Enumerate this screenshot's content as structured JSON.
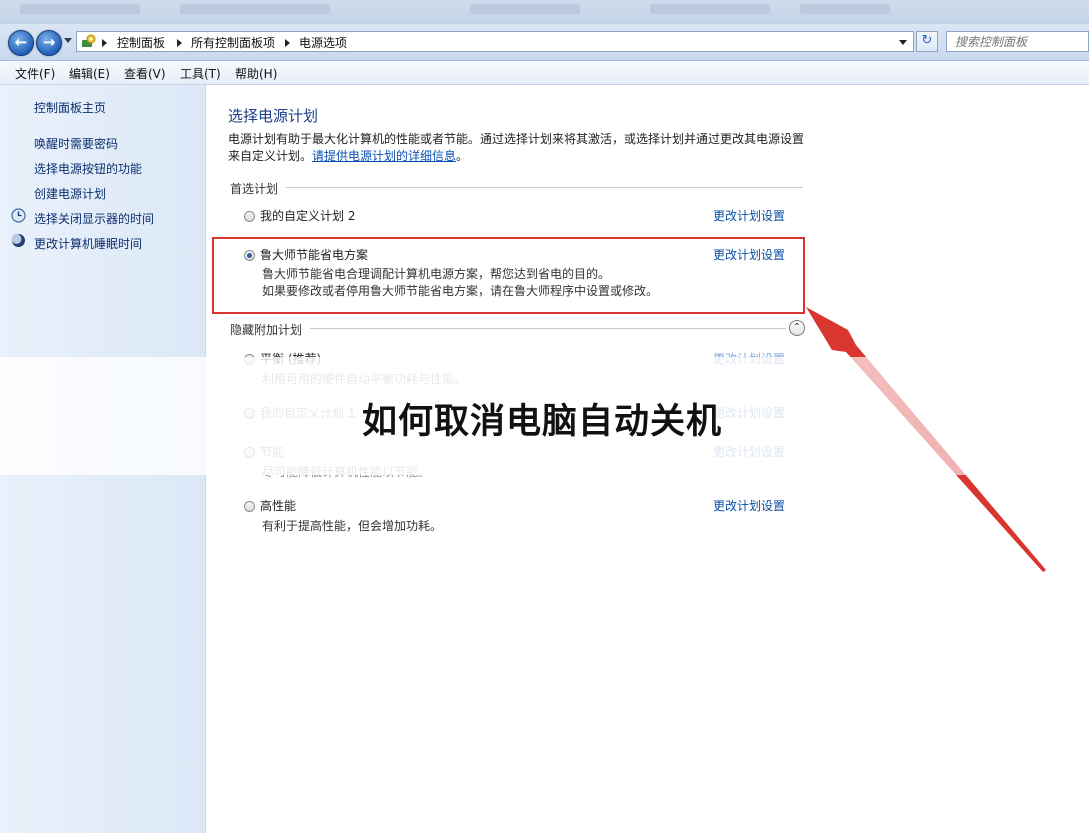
{
  "address": {
    "crumbs": [
      "控制面板",
      "所有控制面板项",
      "电源选项"
    ],
    "search_placeholder": "搜索控制面板"
  },
  "menu": [
    "文件(F)",
    "编辑(E)",
    "查看(V)",
    "工具(T)",
    "帮助(H)"
  ],
  "sidebar": {
    "home": "控制面板主页",
    "items": [
      {
        "label": "唤醒时需要密码",
        "icon": null
      },
      {
        "label": "选择电源按钮的功能",
        "icon": null
      },
      {
        "label": "创建电源计划",
        "icon": null
      },
      {
        "label": "选择关闭显示器的时间",
        "icon": "monitor-clock-icon"
      },
      {
        "label": "更改计算机睡眠时间",
        "icon": "moon-icon"
      }
    ]
  },
  "main": {
    "title": "选择电源计划",
    "description_text": "电源计划有助于最大化计算机的性能或者节能。通过选择计划来将其激活，或选择计划并通过更改其电源设置来自定义计划。",
    "description_link": "请提供电源计划的详细信息",
    "description_end": "。",
    "preferred_label": "首选计划",
    "hidden_label": "隐藏附加计划",
    "change_label": "更改计划设置",
    "preferred_plans": [
      {
        "name": "我的自定义计划 2",
        "selected": false,
        "desc": []
      },
      {
        "name": "鲁大师节能省电方案",
        "selected": true,
        "desc": [
          "鲁大师节能省电合理调配计算机电源方案，帮您达到省电的目的。",
          "如果要修改或者停用鲁大师节能省电方案，请在鲁大师程序中设置或修改。"
        ]
      }
    ],
    "hidden_plans": [
      {
        "name": "平衡 (推荐)",
        "selected": false,
        "desc": "利用可用的硬件自动平衡功耗与性能。"
      },
      {
        "name": "我的自定义计划 1",
        "selected": false,
        "desc": ""
      },
      {
        "name": "节能",
        "selected": false,
        "desc": "尽可能降低计算机性能以节能。"
      },
      {
        "name": "高性能",
        "selected": false,
        "desc": "有利于提高性能，但会增加功耗。"
      }
    ]
  },
  "overlay": {
    "title": "如何取消电脑自动关机",
    "highlight_color": "#d8362f"
  }
}
